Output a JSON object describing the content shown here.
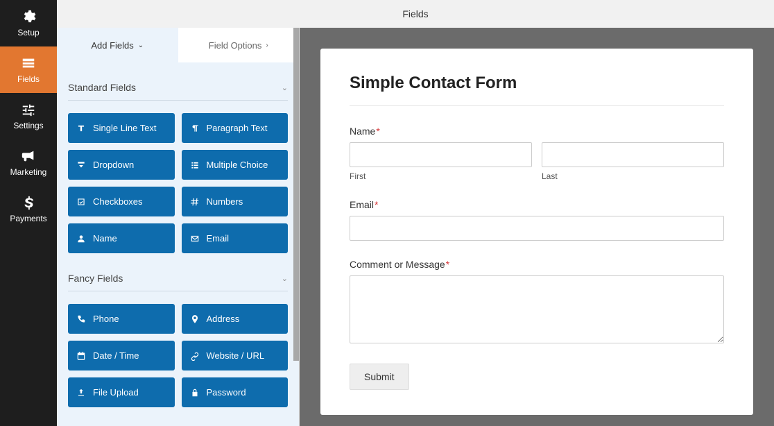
{
  "nav": {
    "items": [
      {
        "label": "Setup"
      },
      {
        "label": "Fields"
      },
      {
        "label": "Settings"
      },
      {
        "label": "Marketing"
      },
      {
        "label": "Payments"
      }
    ]
  },
  "header": {
    "title": "Fields"
  },
  "panel": {
    "tabs": [
      {
        "label": "Add Fields"
      },
      {
        "label": "Field Options"
      }
    ],
    "sections": {
      "standard": {
        "title": "Standard Fields",
        "items": [
          {
            "label": "Single Line Text"
          },
          {
            "label": "Paragraph Text"
          },
          {
            "label": "Dropdown"
          },
          {
            "label": "Multiple Choice"
          },
          {
            "label": "Checkboxes"
          },
          {
            "label": "Numbers"
          },
          {
            "label": "Name"
          },
          {
            "label": "Email"
          }
        ]
      },
      "fancy": {
        "title": "Fancy Fields",
        "items": [
          {
            "label": "Phone"
          },
          {
            "label": "Address"
          },
          {
            "label": "Date / Time"
          },
          {
            "label": "Website / URL"
          },
          {
            "label": "File Upload"
          },
          {
            "label": "Password"
          }
        ]
      }
    }
  },
  "form": {
    "title": "Simple Contact Form",
    "name_label": "Name",
    "first_sub": "First",
    "last_sub": "Last",
    "email_label": "Email",
    "message_label": "Comment or Message",
    "submit": "Submit",
    "required_mark": "*"
  }
}
